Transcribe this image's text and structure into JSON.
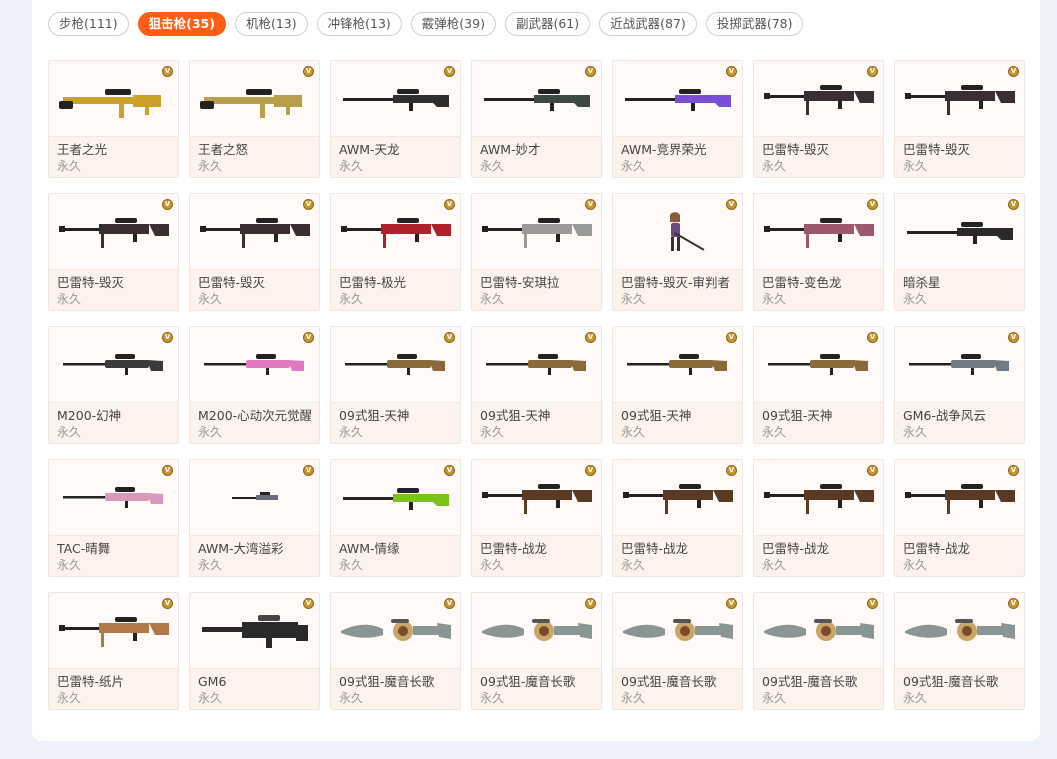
{
  "tabs": [
    {
      "label": "步枪(111)",
      "active": false
    },
    {
      "label": "狙击枪(35)",
      "active": true
    },
    {
      "label": "机枪(13)",
      "active": false
    },
    {
      "label": "冲锋枪(13)",
      "active": false
    },
    {
      "label": "霰弹枪(39)",
      "active": false
    },
    {
      "label": "副武器(61)",
      "active": false
    },
    {
      "label": "近战武器(87)",
      "active": false
    },
    {
      "label": "投掷武器(78)",
      "active": false
    }
  ],
  "badge_label": "V",
  "colors": {
    "accent": "#ff5e14",
    "badge": "#c9962e",
    "card_info_bg": "#fdf2ec"
  },
  "items": [
    {
      "name": "王者之光",
      "duration": "永久",
      "color": "#c9a227",
      "style": "heavy"
    },
    {
      "name": "王者之怒",
      "duration": "永久",
      "color": "#b8a04a",
      "style": "heavy"
    },
    {
      "name": "AWM-天龙",
      "duration": "永久",
      "color": "#2f2f2f",
      "style": "awm"
    },
    {
      "name": "AWM-妙才",
      "duration": "永久",
      "color": "#3d4a44",
      "style": "awm"
    },
    {
      "name": "AWM-竞界荣光",
      "duration": "永久",
      "color": "#7a4fd6",
      "style": "awm"
    },
    {
      "name": "巴雷特-毁灭",
      "duration": "永久",
      "color": "#3a2e33",
      "style": "barrett"
    },
    {
      "name": "巴雷特-毁灭",
      "duration": "永久",
      "color": "#3a2e33",
      "style": "barrett"
    },
    {
      "name": "巴雷特-毁灭",
      "duration": "永久",
      "color": "#3a2e33",
      "style": "barrett"
    },
    {
      "name": "巴雷特-毁灭",
      "duration": "永久",
      "color": "#3a2e33",
      "style": "barrett"
    },
    {
      "name": "巴雷特-极光",
      "duration": "永久",
      "color": "#b0202a",
      "style": "barrett"
    },
    {
      "name": "巴雷特-安琪拉",
      "duration": "永久",
      "color": "#9a9a9a",
      "style": "barrett"
    },
    {
      "name": "巴雷特-毁灭-审判者",
      "duration": "永久",
      "color": "#6b4a7a",
      "style": "figure"
    },
    {
      "name": "巴雷特-变色龙",
      "duration": "永久",
      "color": "#9a5a6a",
      "style": "barrett"
    },
    {
      "name": "暗杀星",
      "duration": "永久",
      "color": "#2a2a2a",
      "style": "awm"
    },
    {
      "name": "M200-幻神",
      "duration": "永久",
      "color": "#3a3a3a",
      "style": "thin"
    },
    {
      "name": "M200-心动次元觉醒",
      "duration": "永久",
      "color": "#e07ac0",
      "style": "thin"
    },
    {
      "name": "09式狙-天神",
      "duration": "永久",
      "color": "#8a6a3a",
      "style": "thin"
    },
    {
      "name": "09式狙-天神",
      "duration": "永久",
      "color": "#8a6a3a",
      "style": "thin"
    },
    {
      "name": "09式狙-天神",
      "duration": "永久",
      "color": "#8a6a3a",
      "style": "thin"
    },
    {
      "name": "09式狙-天神",
      "duration": "永久",
      "color": "#8a6a3a",
      "style": "thin"
    },
    {
      "name": "GM6-战争风云",
      "duration": "永久",
      "color": "#707a84",
      "style": "thin"
    },
    {
      "name": "TAC-晴舞",
      "duration": "永久",
      "color": "#d89ab8",
      "style": "thin"
    },
    {
      "name": "AWM-大湾溢彩",
      "duration": "永久",
      "color": "#6a6a7a",
      "style": "tiny"
    },
    {
      "name": "AWM-情缘",
      "duration": "永久",
      "color": "#7ac21e",
      "style": "awm"
    },
    {
      "name": "巴雷特-战龙",
      "duration": "永久",
      "color": "#5a3a22",
      "style": "barrett"
    },
    {
      "name": "巴雷特-战龙",
      "duration": "永久",
      "color": "#5a3a22",
      "style": "barrett"
    },
    {
      "name": "巴雷特-战龙",
      "duration": "永久",
      "color": "#5a3a22",
      "style": "barrett"
    },
    {
      "name": "巴雷特-战龙",
      "duration": "永久",
      "color": "#5a3a22",
      "style": "barrett"
    },
    {
      "name": "巴雷特-纸片",
      "duration": "永久",
      "color": "#b07a48",
      "style": "barrett"
    },
    {
      "name": "GM6",
      "duration": "永久",
      "color": "#2a2a2a",
      "style": "gm6"
    },
    {
      "name": "09式狙-魔音长歌",
      "duration": "永久",
      "color": "#8a9694",
      "style": "ornate"
    },
    {
      "name": "09式狙-魔音长歌",
      "duration": "永久",
      "color": "#8a9694",
      "style": "ornate"
    },
    {
      "name": "09式狙-魔音长歌",
      "duration": "永久",
      "color": "#8a9694",
      "style": "ornate"
    },
    {
      "name": "09式狙-魔音长歌",
      "duration": "永久",
      "color": "#8a9694",
      "style": "ornate"
    },
    {
      "name": "09式狙-魔音长歌",
      "duration": "永久",
      "color": "#8a9694",
      "style": "ornate"
    }
  ]
}
